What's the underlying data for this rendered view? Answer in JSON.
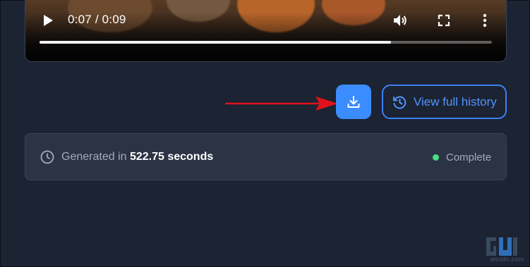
{
  "video": {
    "current_time": "0:07",
    "separator": " / ",
    "duration": "0:09",
    "progress_fraction": 0.777
  },
  "actions": {
    "history_label": "View full history"
  },
  "status": {
    "generated_prefix": "Generated in ",
    "generated_seconds": "522.75 seconds",
    "state": "Complete",
    "state_color": "#4ade80"
  },
  "annotation": {
    "arrow_color": "#e0131c"
  },
  "watermark": {
    "logo": "gadgets-to-use-logo",
    "site": "wsxdn.com"
  },
  "colors": {
    "accent": "#3b8cff",
    "background": "#1c2333",
    "card": "#2b3344"
  }
}
